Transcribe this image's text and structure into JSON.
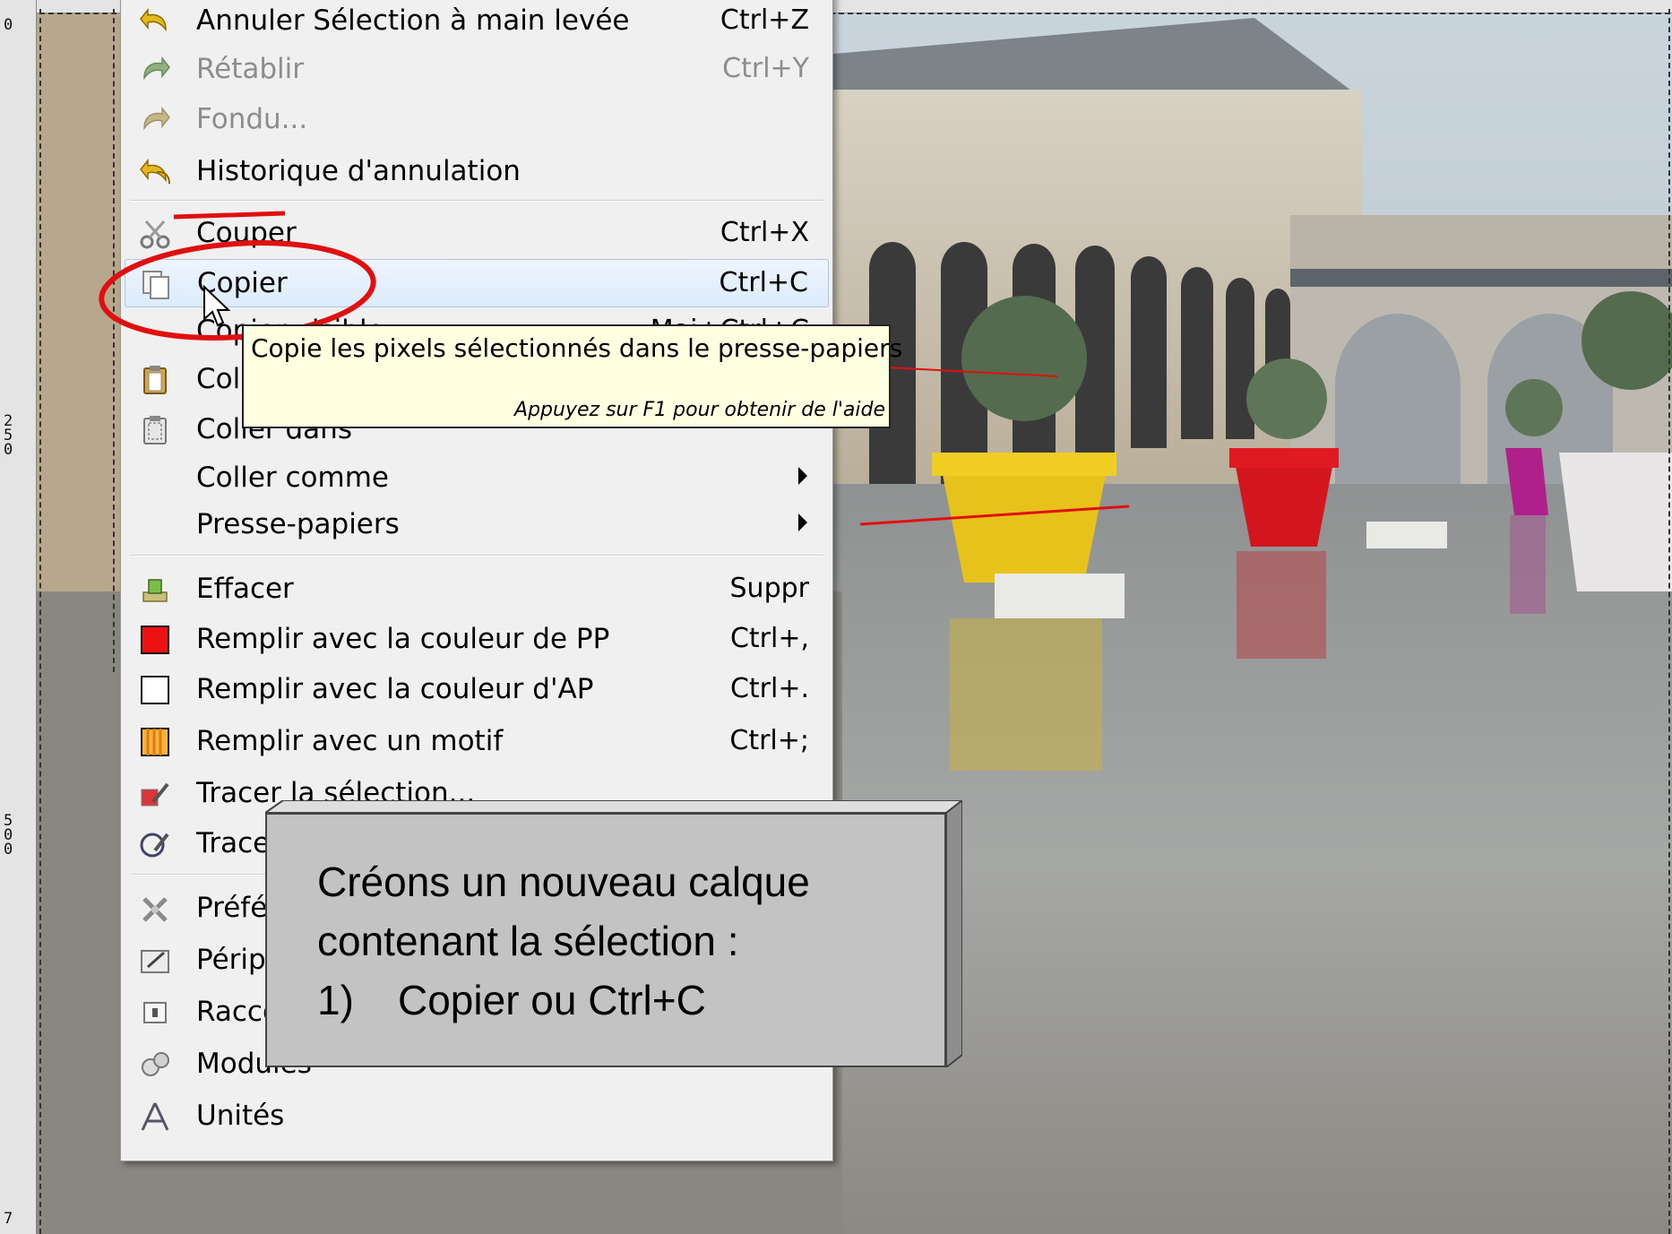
{
  "rulers": {
    "top_labels": [],
    "left_labels": [
      "0",
      "250",
      "500",
      "7"
    ]
  },
  "menu": {
    "items": [
      {
        "label": "Annuler Sélection à main levée",
        "shortcut": "Ctrl+Z",
        "icon": "undo-icon",
        "disabled": false
      },
      {
        "label": "Rétablir",
        "shortcut": "Ctrl+Y",
        "icon": "redo-icon",
        "disabled": true
      },
      {
        "label": "Fondu...",
        "shortcut": "",
        "icon": "fade-icon",
        "disabled": true
      },
      {
        "label": "Historique d'annulation",
        "shortcut": "",
        "icon": "undo-history-icon",
        "disabled": false
      },
      {
        "label": "Couper",
        "shortcut": "Ctrl+X",
        "icon": "cut-icon",
        "disabled": false
      },
      {
        "label": "Copier",
        "shortcut": "Ctrl+C",
        "icon": "copy-icon",
        "disabled": false,
        "highlighted": true
      },
      {
        "label": "Copier visible",
        "shortcut": "Maj+Ctrl+C",
        "icon": "",
        "disabled": false
      },
      {
        "label": "Coller",
        "shortcut": "",
        "icon": "paste-icon",
        "disabled": false
      },
      {
        "label": "Coller dans",
        "shortcut": "",
        "icon": "paste-into-icon",
        "disabled": false
      },
      {
        "label": "Coller comme",
        "shortcut": "",
        "icon": "",
        "disabled": false,
        "submenu": true
      },
      {
        "label": "Presse-papiers",
        "shortcut": "",
        "icon": "",
        "disabled": false,
        "submenu": true
      },
      {
        "label": "Effacer",
        "shortcut": "Suppr",
        "icon": "clear-icon",
        "disabled": false
      },
      {
        "label": "Remplir avec la couleur de PP",
        "shortcut": "Ctrl+,",
        "icon": "fg-color-icon",
        "disabled": false
      },
      {
        "label": "Remplir avec la couleur d'AP",
        "shortcut": "Ctrl+.",
        "icon": "bg-color-icon",
        "disabled": false
      },
      {
        "label": "Remplir avec un motif",
        "shortcut": "Ctrl+;",
        "icon": "pattern-icon",
        "disabled": false
      },
      {
        "label": "Tracer la sélection...",
        "shortcut": "",
        "icon": "stroke-selection-icon",
        "disabled": false
      },
      {
        "label": "Tracer le chemin...",
        "shortcut": "",
        "icon": "stroke-path-icon",
        "disabled": false
      },
      {
        "label": "Préférences",
        "shortcut": "",
        "icon": "preferences-icon",
        "disabled": false
      },
      {
        "label": "Périphériques d'entrée",
        "shortcut": "",
        "icon": "input-devices-icon",
        "disabled": false
      },
      {
        "label": "Raccourcis clavier",
        "shortcut": "",
        "icon": "keyboard-shortcuts-icon",
        "disabled": false
      },
      {
        "label": "Modules",
        "shortcut": "",
        "icon": "modules-icon",
        "disabled": false
      },
      {
        "label": "Unités",
        "shortcut": "",
        "icon": "units-icon",
        "disabled": false
      }
    ]
  },
  "tooltip": {
    "text": "Copie les pixels sélectionnés dans le presse-papiers",
    "help": "Appuyez sur F1 pour obtenir de l'aide"
  },
  "callout": {
    "line1": "Créons un nouveau calque",
    "line2": "contenant la sélection :",
    "step_number": "1)",
    "step_text": "Copier ou Ctrl+C"
  },
  "colors": {
    "annotation_red": "#e01010",
    "fg_swatch": "#ee1111",
    "bg_swatch": "#ffffff",
    "highlight": "#dcebfc"
  }
}
